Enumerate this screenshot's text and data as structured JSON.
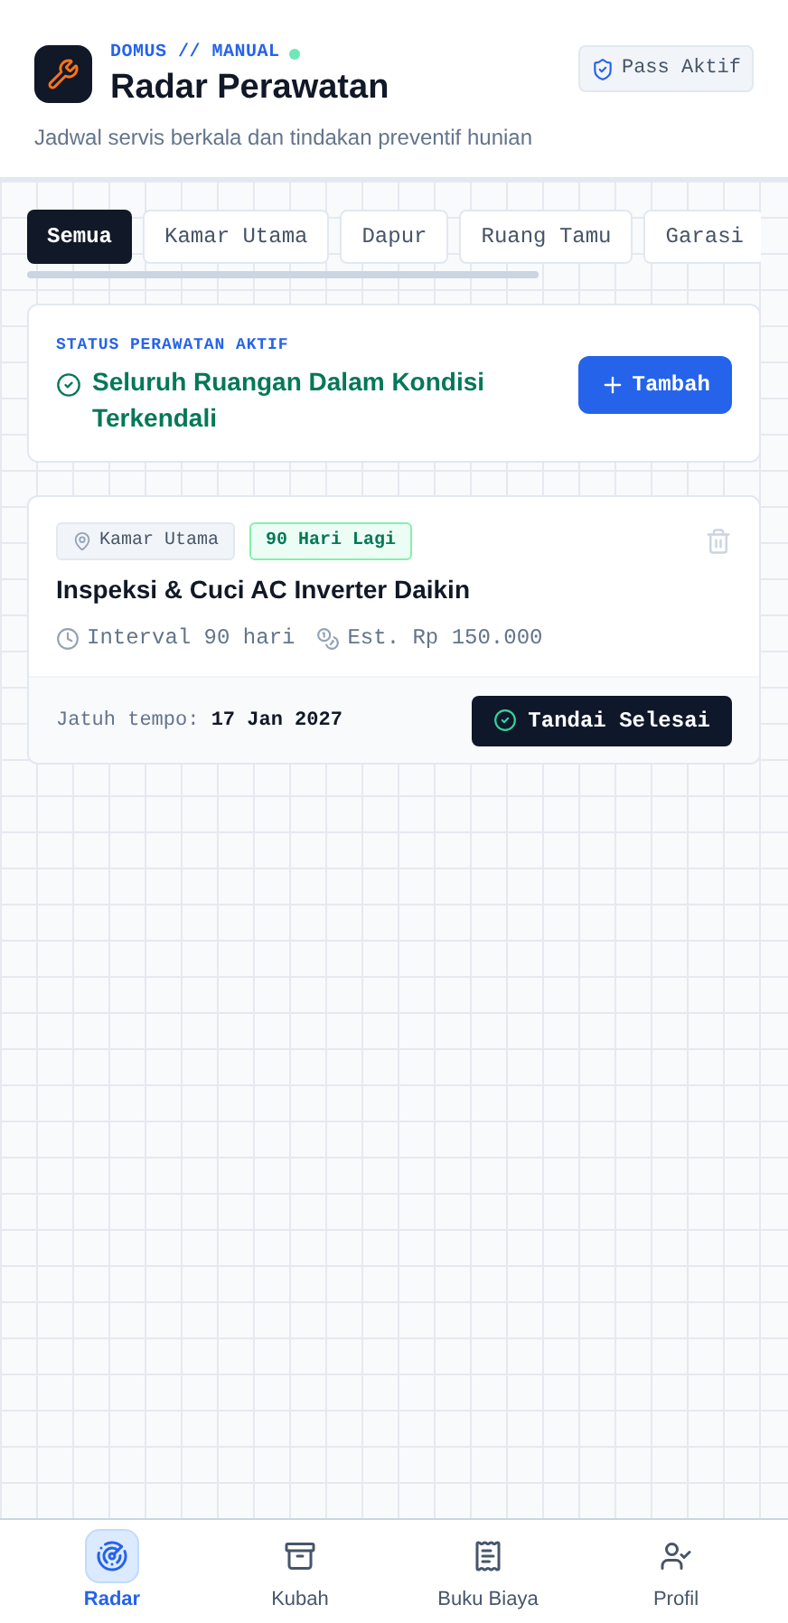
{
  "header": {
    "eyebrow": "DOMUS // MANUAL",
    "title": "Radar Perawatan",
    "subtitle": "Jadwal servis berkala dan tindakan preventif hunian",
    "status_online": true,
    "pass": "Pass Aktif"
  },
  "tabs": [
    {
      "label": "Semua",
      "selected": true
    },
    {
      "label": "Kamar Utama",
      "selected": false
    },
    {
      "label": "Dapur",
      "selected": false
    },
    {
      "label": "Ruang Tamu",
      "selected": false
    },
    {
      "label": "Garasi",
      "selected": false
    }
  ],
  "status": {
    "label": "STATUS PERAWATAN AKTIF",
    "message": "Seluruh Ruangan Dalam Kondisi Terkendali",
    "add_button": "Tambah"
  },
  "tasks": [
    {
      "location": "Kamar Utama",
      "due_badge": "90 Hari Lagi",
      "title": "Inspeksi & Cuci AC Inverter Daikin",
      "interval": "Interval 90 hari",
      "cost": "Est. Rp 150.000",
      "due_label": "Jatuh tempo:",
      "due_date": "17 Jan 2027",
      "done_button": "Tandai Selesai"
    }
  ],
  "nav": [
    {
      "label": "Radar",
      "selected": true
    },
    {
      "label": "Kubah",
      "selected": false
    },
    {
      "label": "Buku Biaya",
      "selected": false
    },
    {
      "label": "Profil",
      "selected": false
    }
  ]
}
